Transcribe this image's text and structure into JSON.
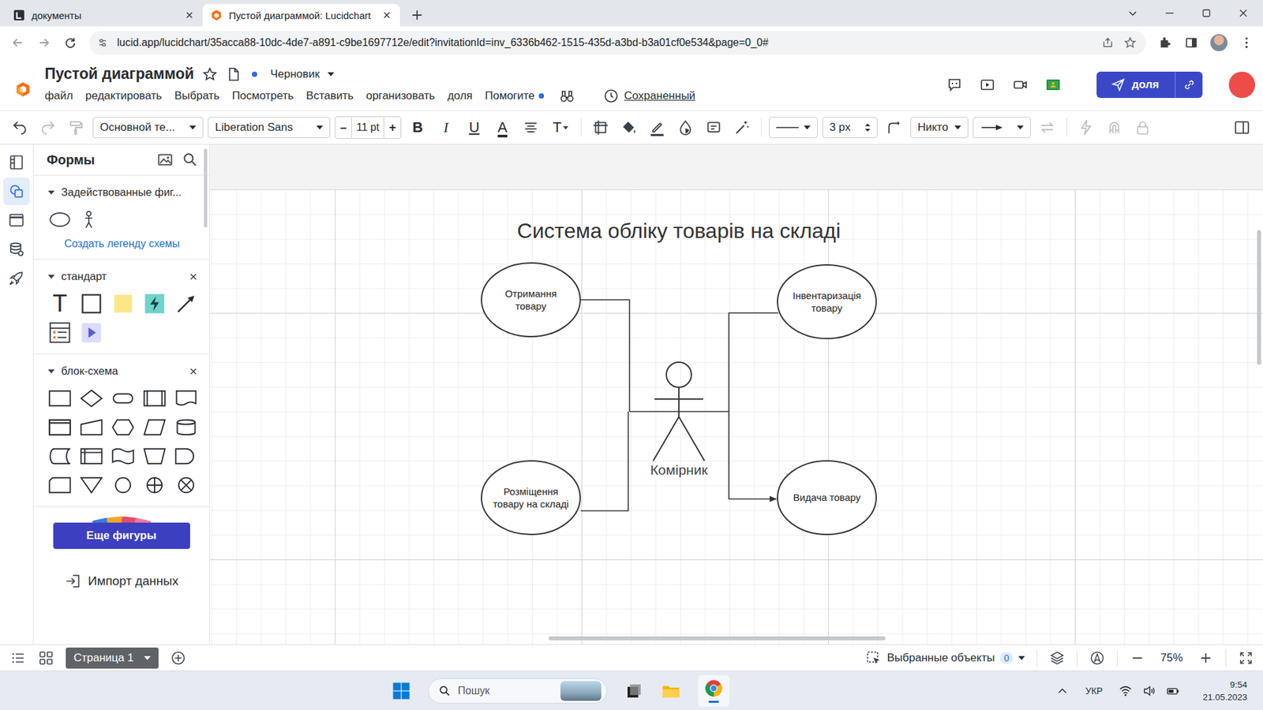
{
  "browser": {
    "tabs": [
      {
        "label": "документы",
        "selected": false
      },
      {
        "label": "Пустой диаграммой: Lucidchart",
        "selected": true
      }
    ],
    "url": "lucid.app/lucidchart/35acca88-10dc-4de7-a891-c9be1697712e/edit?invitationId=inv_6336b462-1515-435d-a3bd-b3a01cf0e534&page=0_0#"
  },
  "app": {
    "title": "Пустой диаграммой",
    "starred": false,
    "unsaved_dot": true,
    "status": "Черновик",
    "menu": [
      {
        "label": "файл",
        "dot": false
      },
      {
        "label": "редактировать",
        "dot": false
      },
      {
        "label": "Выбрать",
        "dot": false
      },
      {
        "label": "Посмотреть",
        "dot": false
      },
      {
        "label": "Вставить",
        "dot": false
      },
      {
        "label": "организовать",
        "dot": false
      },
      {
        "label": "доля",
        "dot": false
      },
      {
        "label": "Помогите",
        "dot": true
      }
    ],
    "saved": "Сохраненный",
    "share_button": "доля"
  },
  "toolbar": {
    "text_style": "Основной те...",
    "font": "Liberation Sans",
    "decrease": "–",
    "font_size": "11 pt",
    "increase": "+",
    "format_buttons": [
      "B",
      "I",
      "U",
      "A"
    ],
    "text_options": "T",
    "line_width": "3 px",
    "line_end": "Никто"
  },
  "rail": [
    {
      "selected": false
    },
    {
      "selected": true
    },
    {
      "selected": false
    },
    {
      "selected": false
    },
    {
      "selected": false
    }
  ],
  "shapes_panel": {
    "title": "Формы",
    "sections": [
      {
        "title": "Задействованные фиг...",
        "expanded": true,
        "closable": false
      },
      {
        "title": "стандарт",
        "expanded": true,
        "closable": true
      },
      {
        "title": "блок-схема",
        "expanded": true,
        "closable": true
      }
    ],
    "legend_link": "Создать легенду схемы",
    "text_shape": "T",
    "more_button": "Еще фигуры",
    "import": "Импорт данных"
  },
  "diagram": {
    "title": "Система обліку товарів на складі",
    "use_cases": [
      {
        "lines": [
          "Отримання",
          "товару"
        ]
      },
      {
        "lines": [
          "Інвентаризація",
          "товару"
        ]
      },
      {
        "lines": [
          "Розміщення",
          "товару на складі"
        ]
      },
      {
        "lines": [
          "Видача товару"
        ]
      }
    ],
    "actor": "Комірник",
    "links": [
      {
        "arrow": false
      },
      {
        "arrow": false
      },
      {
        "arrow": false
      },
      {
        "arrow": true
      }
    ]
  },
  "bottom_bar": {
    "page": "Страница 1",
    "selected_label": "Выбранные объекты",
    "selected_count": "0",
    "zoom": "75%"
  },
  "taskbar": {
    "search": "Пошук",
    "language": "УКР",
    "time": "9:54",
    "date": "21.05.2023"
  }
}
